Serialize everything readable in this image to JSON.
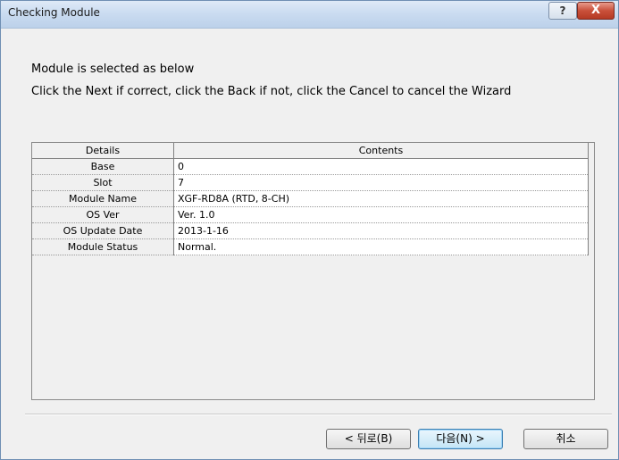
{
  "window": {
    "title": "Checking Module",
    "help_glyph": "?",
    "close_glyph": "X"
  },
  "message": {
    "line1": "Module is selected as below",
    "line2": "Click the Next if correct, click the Back if not, click the Cancel to cancel the Wizard"
  },
  "table": {
    "headers": [
      "Details",
      "Contents"
    ],
    "rows": [
      {
        "label": "Base",
        "value": "0"
      },
      {
        "label": "Slot",
        "value": "7"
      },
      {
        "label": "Module Name",
        "value": "XGF-RD8A (RTD, 8-CH)"
      },
      {
        "label": "OS Ver",
        "value": "Ver.  1.0"
      },
      {
        "label": "OS Update Date",
        "value": "2013-1-16"
      },
      {
        "label": "Module Status",
        "value": "Normal."
      }
    ]
  },
  "buttons": {
    "back": "< 뒤로(B)",
    "next": "다음(N) >",
    "cancel": "취소"
  }
}
